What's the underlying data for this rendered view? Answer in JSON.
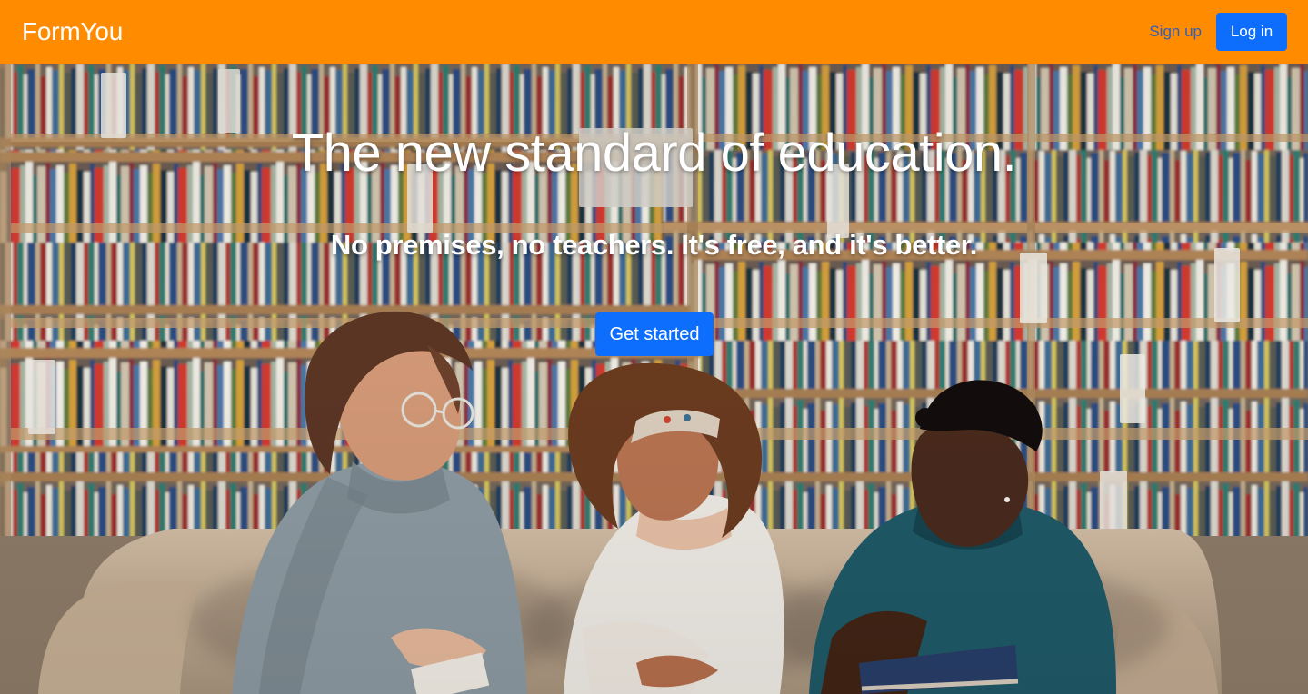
{
  "navbar": {
    "brand": "FormYou",
    "sign_up_label": "Sign up",
    "log_in_label": "Log in",
    "background_color": "#ff8c00",
    "primary_color": "#0d6efd"
  },
  "hero": {
    "title": "The new standard of education.",
    "subtitle": "No premises, no teachers. It's free, and it's better.",
    "cta_label": "Get started",
    "photo_subject": "three-students-reading-books-in-library"
  }
}
